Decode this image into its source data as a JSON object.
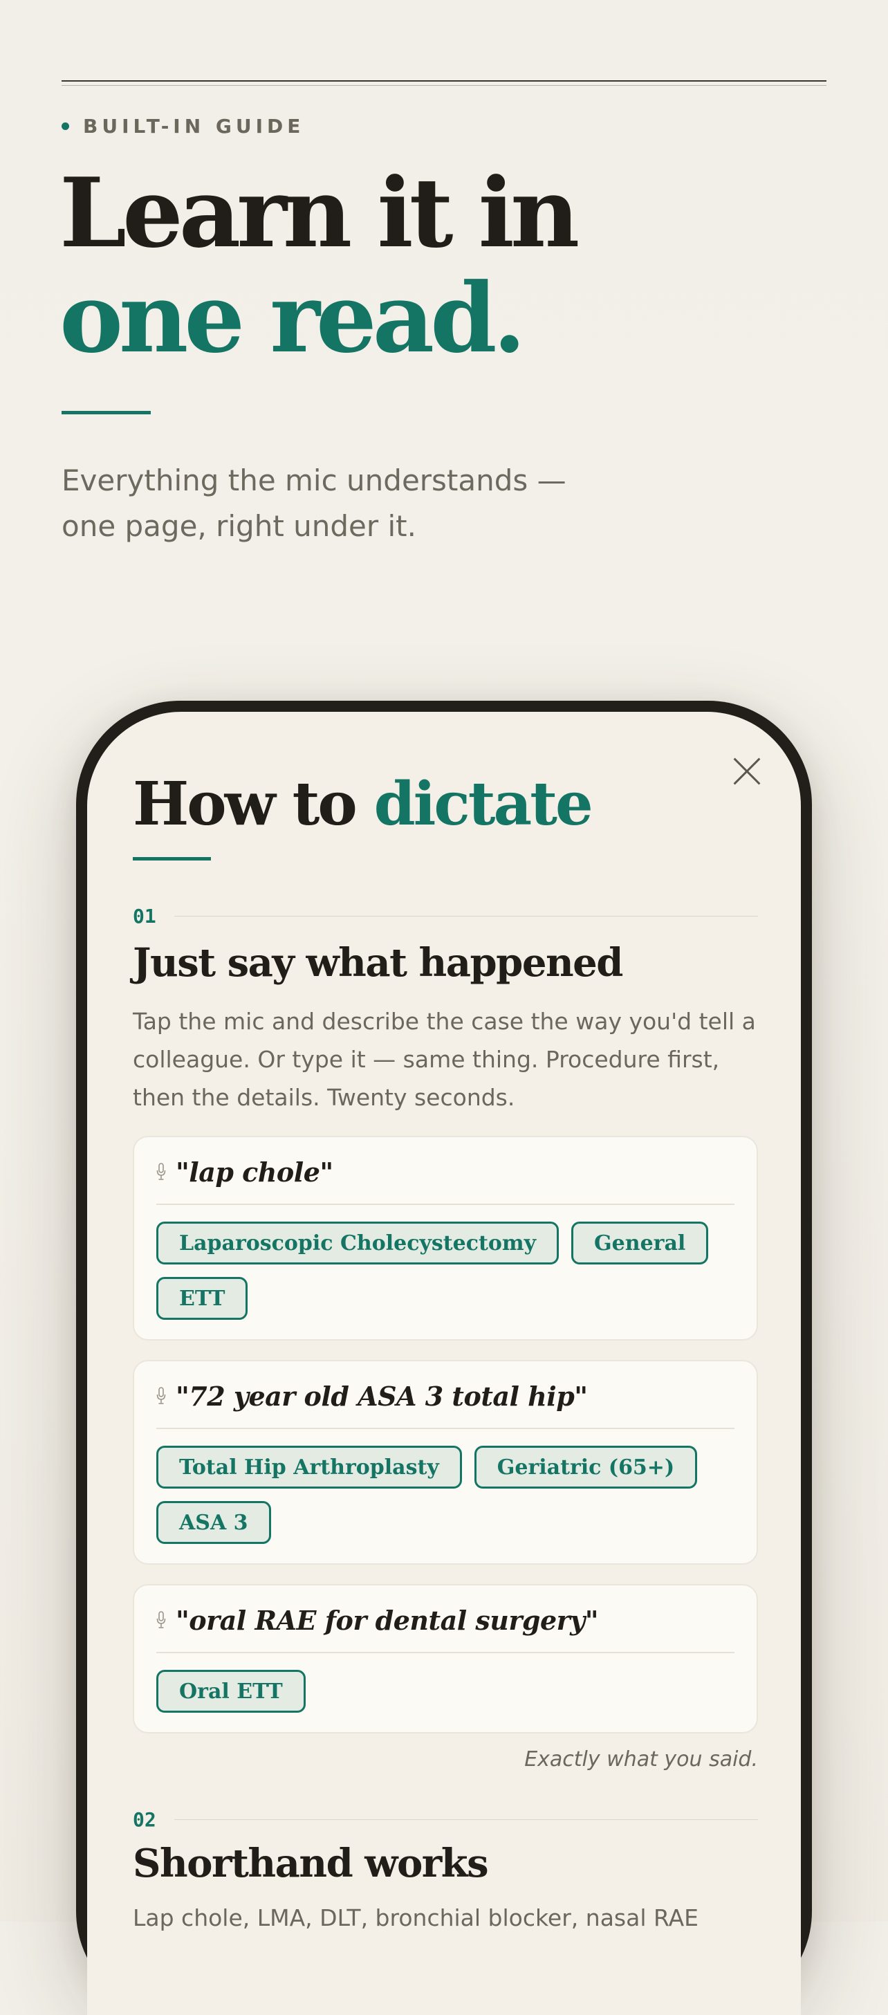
{
  "header": {
    "eyebrow": "BUILT-IN GUIDE",
    "title_line1": "Learn it in",
    "title_line2": "one read.",
    "subtitle": "Everything the mic understands — one page, right under it."
  },
  "sheet": {
    "title_main": "How to ",
    "title_accent": "dictate",
    "close_icon": "close-icon",
    "steps": [
      {
        "number": "01",
        "title": "Just say what happened",
        "body": "Tap the mic and describe the case the way you'd tell a colleague. Or type it — same thing. Procedure first, then the details. Twenty seconds.",
        "examples": [
          {
            "quote": "\"lap chole\"",
            "chips": [
              "Laparoscopic Cholecystectomy",
              "General",
              "ETT"
            ]
          },
          {
            "quote": "\"72 year old ASA 3 total hip\"",
            "chips": [
              "Total Hip Arthroplasty",
              "Geriatric (65+)",
              "ASA 3"
            ]
          },
          {
            "quote": "\"oral RAE for dental surgery\"",
            "chips": [
              "Oral ETT"
            ]
          }
        ],
        "caption": "Exactly what you said."
      },
      {
        "number": "02",
        "title": "Shorthand works",
        "body": "Lap chole, LMA, DLT, bronchial blocker, nasal RAE"
      }
    ]
  },
  "colors": {
    "accent": "#147564",
    "ink": "#211e19",
    "muted": "#6c675d",
    "background": "#f2efe8",
    "chip_fill": "#e3ebe3"
  }
}
